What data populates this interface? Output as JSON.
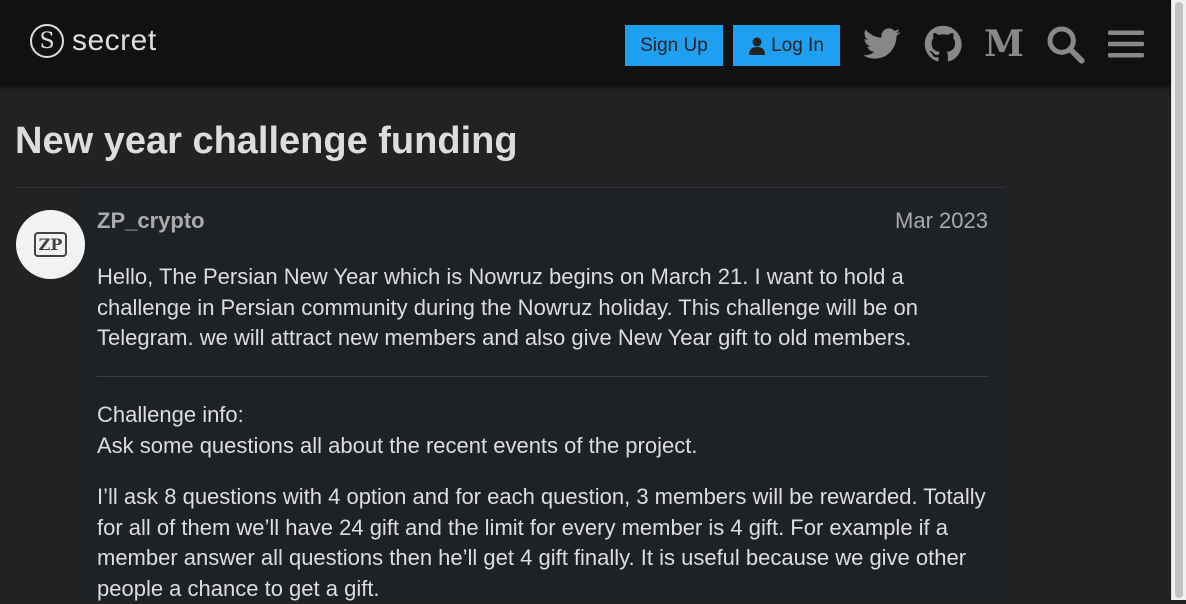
{
  "header": {
    "logo_text": "secret",
    "signup_label": "Sign Up",
    "login_label": "Log In",
    "icons": [
      "twitter-icon",
      "github-icon",
      "medium-icon",
      "search-icon",
      "menu-icon"
    ],
    "medium_glyph": "M"
  },
  "topic": {
    "title": "New year challenge funding"
  },
  "post": {
    "avatar_text": "ZP",
    "username": "ZP_crypto",
    "date": "Mar 2023",
    "paragraph1": "Hello, The Persian New Year which is Nowruz begins on March 21. I want to hold a challenge in Persian community during the Nowruz holiday. This challenge will be on Telegram. we will attract new members and also give New Year gift to old members.",
    "challenge_heading": "Challenge info:",
    "challenge_line": "Ask some questions all about the recent events of the project.",
    "paragraph3": "I’ll ask 8 questions with 4 option and for each question, 3 members will be rewarded. Totally for all of them we’ll have 24 gift and the limit for every member is 4 gift. For example if a member answer all questions then he’ll get 4 gift finally. It is useful because we give other people a chance to get a gift."
  },
  "colors": {
    "accent": "#1e9ff2",
    "background": "#222222",
    "header": "#111111"
  }
}
